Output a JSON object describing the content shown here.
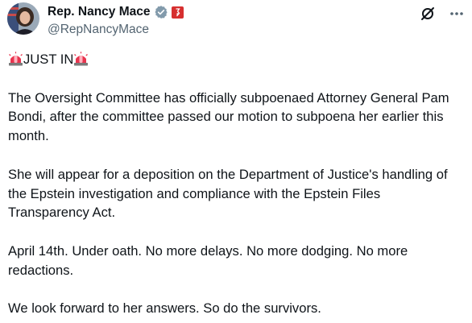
{
  "author": {
    "display_name": "Rep. Nancy Mace",
    "handle": "@RepNancyMace"
  },
  "icons": {
    "verified": "verified-badge-icon",
    "affiliation": "affiliation-badge-icon",
    "grok": "grok-icon",
    "more": "more-icon",
    "siren": "siren-emoji-icon"
  },
  "colors": {
    "verified_badge": "#829aab",
    "affiliation_badge": "#d62f2f",
    "text": "#0f1419",
    "secondary": "#536471",
    "siren": "#e8344e"
  },
  "tweet": {
    "headline": "JUST IN",
    "paragraphs": [
      "The Oversight Committee has officially subpoenaed Attorney General Pam Bondi, after the committee passed our motion to subpoena her earlier this month.",
      "She will appear for a deposition on the Department of Justice's handling of the Epstein investigation and compliance with the Epstein Files Transparency Act.",
      "April 14th. Under oath. No more delays. No more dodging. No more redactions.",
      "We look forward to her answers. So do the survivors."
    ]
  }
}
